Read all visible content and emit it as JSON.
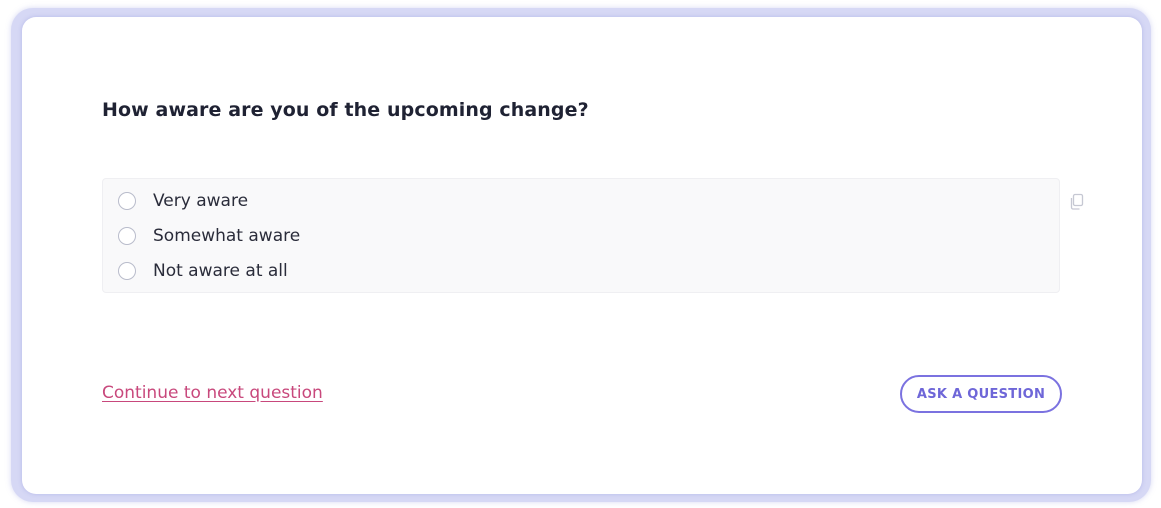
{
  "question": {
    "text": "How aware are you of the upcoming change?"
  },
  "options": [
    {
      "label": "Very aware",
      "selected": false
    },
    {
      "label": "Somewhat aware",
      "selected": false
    },
    {
      "label": "Not aware at all",
      "selected": false
    }
  ],
  "icons": {
    "copy": "copy-icon"
  },
  "actions": {
    "continue_label": "Continue to next question",
    "ask_label": "ASK A QUESTION"
  },
  "colors": {
    "link": "#c8487c",
    "button_accent": "#6e66d8",
    "frame": "#d6d8f5",
    "heading": "#1f2233"
  }
}
